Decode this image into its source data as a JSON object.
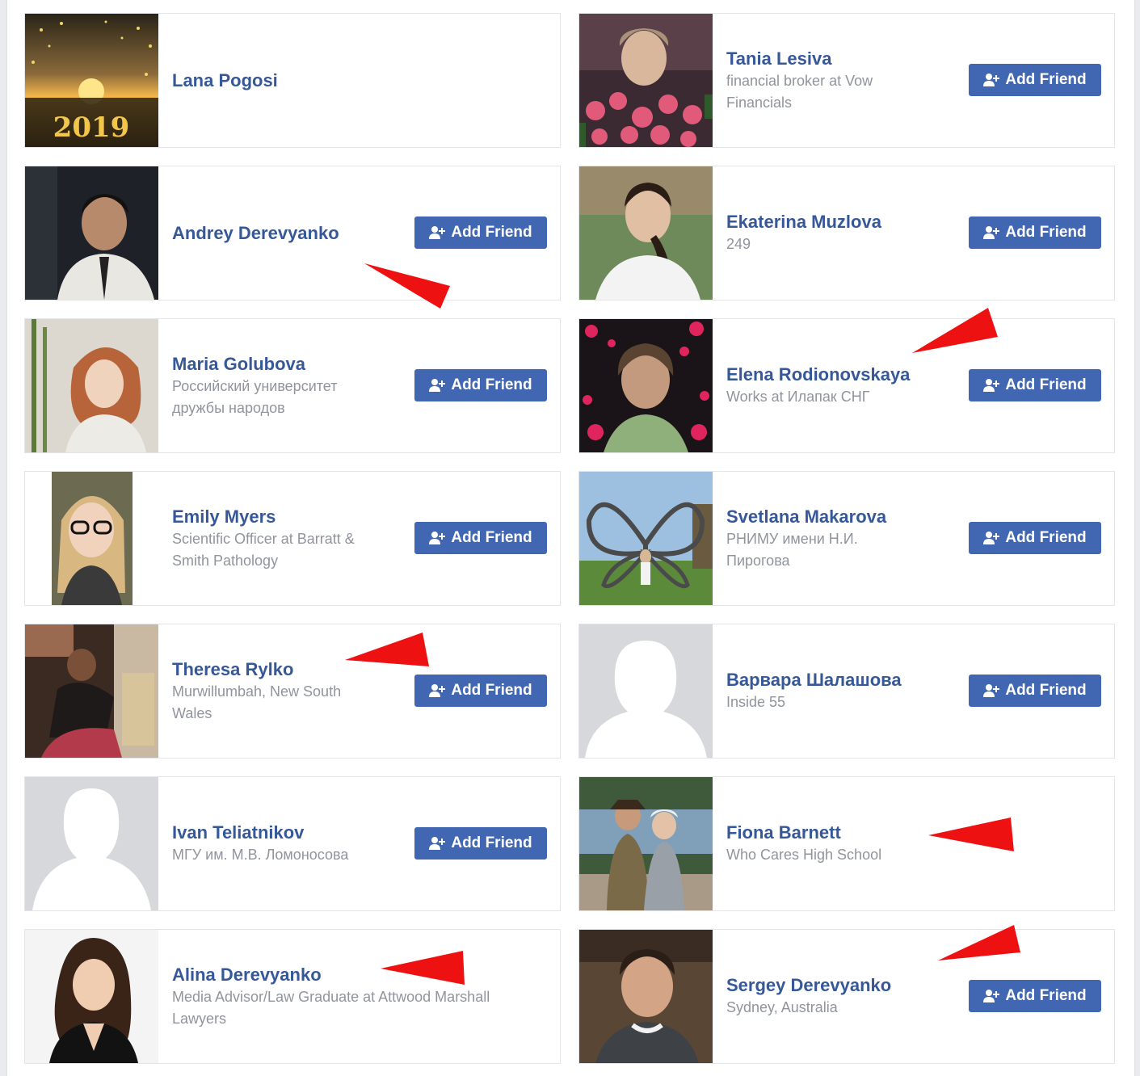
{
  "add_friend_label": "Add Friend",
  "colors": {
    "link": "#365899",
    "button": "#4267b2",
    "arrow": "#ee1111",
    "placeholder": "#d6d8dc"
  },
  "people": [
    {
      "name": "Lana Pogosi",
      "subtitle": [],
      "has_button": false,
      "photo": "new-year-2019-photo",
      "photo_text": "2019"
    },
    {
      "name": "Tania Lesiva",
      "subtitle": [
        "financial broker at Vow",
        "Financials"
      ],
      "has_button": true,
      "photo": "woman-with-roses-photo"
    },
    {
      "name": "Andrey Derevyanko",
      "subtitle": [],
      "has_button": true,
      "photo": "man-in-suit-photo"
    },
    {
      "name": "Ekaterina Muzlova",
      "subtitle": [
        "249"
      ],
      "has_button": true,
      "photo": "woman-outdoors-photo"
    },
    {
      "name": "Maria Golubova",
      "subtitle": [
        "Российский университет",
        "дружбы народов"
      ],
      "has_button": true,
      "photo": "redhead-woman-photo"
    },
    {
      "name": "Elena Rodionovskaya",
      "subtitle": [
        "Works at Илапак СНГ"
      ],
      "has_button": true,
      "photo": "woman-with-hearts-photo"
    },
    {
      "name": "Emily Myers",
      "subtitle": [
        "Scientific Officer at Barratt &",
        "Smith Pathology"
      ],
      "has_button": true,
      "photo": "woman-with-glasses-photo"
    },
    {
      "name": "Svetlana Makarova",
      "subtitle": [
        "РНИМУ имени Н.И.",
        "Пирогова"
      ],
      "has_button": true,
      "photo": "butterfly-sculpture-photo"
    },
    {
      "name": "Theresa Rylko",
      "subtitle": [
        "Murwillumbah, New South",
        "Wales"
      ],
      "has_button": true,
      "photo": "woman-sitting-photo"
    },
    {
      "name": "Варвара Шалашова",
      "subtitle": [
        "Inside 55"
      ],
      "has_button": true,
      "photo": "default-female-avatar"
    },
    {
      "name": "Ivan Teliatnikov",
      "subtitle": [
        "МГУ им. М.В. Ломоносова"
      ],
      "has_button": true,
      "photo": "default-male-avatar"
    },
    {
      "name": "Fiona Barnett",
      "subtitle": [
        "Who Cares High School"
      ],
      "has_button": false,
      "photo": "couple-by-lake-photo"
    },
    {
      "name": "Alina Derevyanko",
      "subtitle": [
        "Media Advisor/Law Graduate at Attwood Marshall",
        "Lawyers"
      ],
      "has_button": false,
      "photo": "woman-portrait-photo"
    },
    {
      "name": "Sergey Derevyanko",
      "subtitle": [
        "Sydney, Australia"
      ],
      "has_button": true,
      "photo": "man-portrait-photo"
    }
  ]
}
